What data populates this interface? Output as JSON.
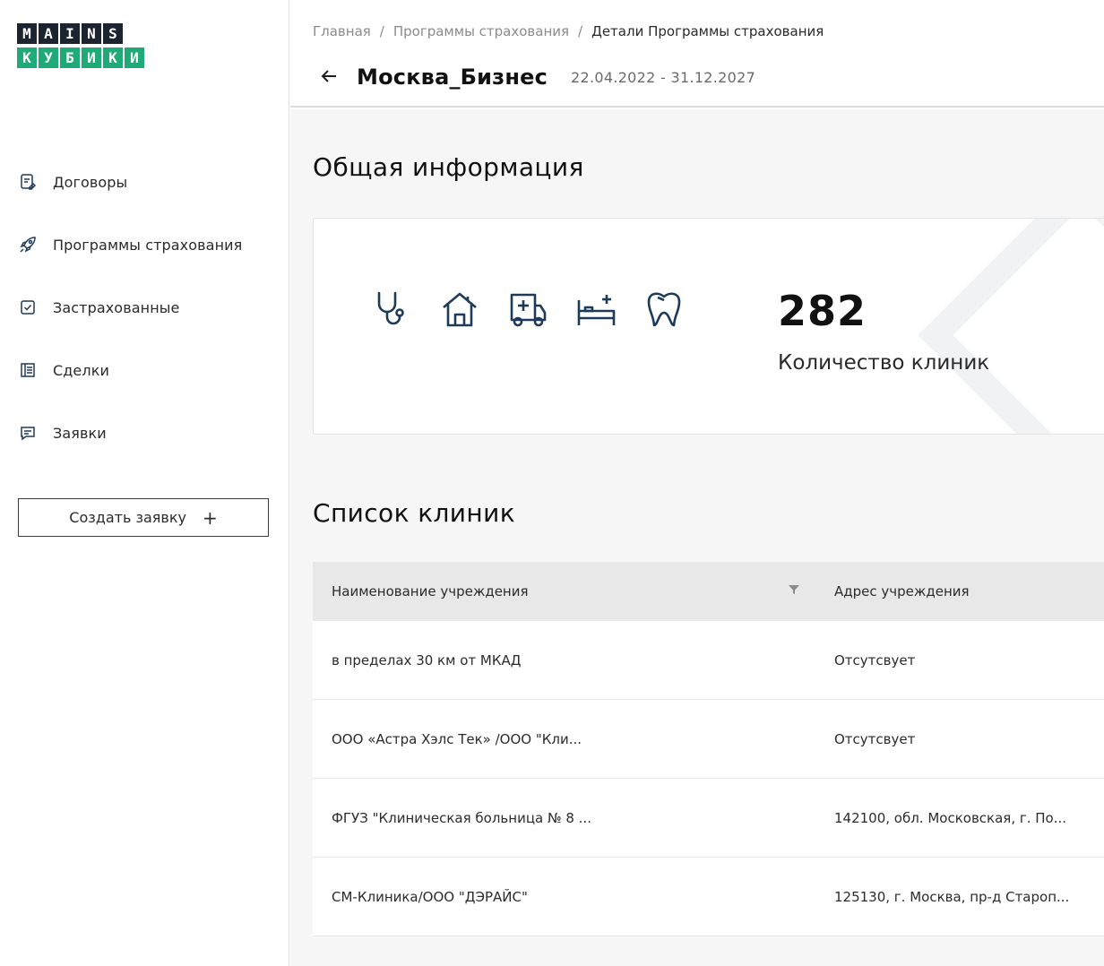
{
  "logo": {
    "top": [
      "M",
      "A",
      "I",
      "N",
      "S"
    ],
    "bottom": [
      "К",
      "У",
      "Б",
      "И",
      "К",
      "И"
    ]
  },
  "sidebar": {
    "items": [
      {
        "label": "Договоры",
        "icon": "contract-icon"
      },
      {
        "label": "Программы страхования",
        "icon": "rocket-icon"
      },
      {
        "label": "Застрахованные",
        "icon": "checkbox-icon"
      },
      {
        "label": "Сделки",
        "icon": "deals-icon"
      },
      {
        "label": "Заявки",
        "icon": "chat-icon"
      }
    ],
    "create_button": {
      "label": "Создать заявку",
      "icon": "plus-icon"
    }
  },
  "header": {
    "breadcrumb": [
      "Главная",
      "Программы страхования",
      "Детали Программы страхования"
    ],
    "separator": "/",
    "title": "Москва_Бизнес",
    "date_range": "22.04.2022 - 31.12.2027"
  },
  "general_info": {
    "title": "Общая информация",
    "services": [
      "stethoscope-icon",
      "home-icon",
      "ambulance-icon",
      "hospital-bed-icon",
      "tooth-icon"
    ],
    "clinic_count": "282",
    "clinic_count_label": "Количество клиник"
  },
  "clinics": {
    "title": "Список клиник",
    "columns": [
      "Наименование учреждения",
      "Адрес учреждения"
    ],
    "rows": [
      {
        "name": "в пределах 30 км от МКАД",
        "address": "Отсутсвует"
      },
      {
        "name": "ООО «Астра Хэлс Тек» /ООО \"Кли...",
        "address": "Отсутсвует"
      },
      {
        "name": "ФГУЗ \"Клиническая больница № 8 ...",
        "address": "142100, обл. Московская, г. По..."
      },
      {
        "name": "СМ-Клиника/ООО \"ДЭРАЙС\"",
        "address": "125130, г. Москва, пр-д Староп..."
      }
    ]
  },
  "colors": {
    "logo_dark": "#1c2430",
    "logo_green": "#1faa78",
    "icon_stroke": "#1e3a5a",
    "background": "#f6f6f6"
  }
}
